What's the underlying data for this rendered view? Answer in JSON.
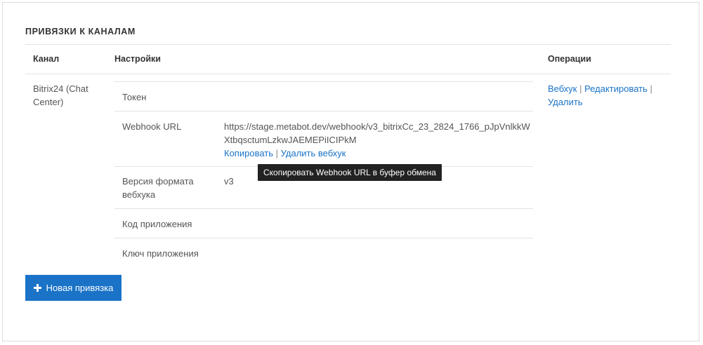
{
  "section": {
    "title": "ПРИВЯЗКИ К КАНАЛАМ"
  },
  "table": {
    "headers": {
      "channel": "Канал",
      "settings": "Настройки",
      "operations": "Операции"
    },
    "row": {
      "channel": "Bitrix24 (Chat Center)",
      "settings": [
        {
          "label": "Токен",
          "value": ""
        },
        {
          "label": "Webhook URL",
          "value": "https://stage.metabot.dev/webhook/v3_bitrixCc_23_2824_1766_pJpVnlkkWXtbqsctumLzkwJAEMEPiICIPkM"
        },
        {
          "label": "Версия формата вебхука",
          "value": "v3"
        },
        {
          "label": "Код приложения",
          "value": ""
        },
        {
          "label": "Ключ приложения",
          "value": ""
        }
      ],
      "webhook_actions": {
        "copy": "Копировать",
        "separator": "|",
        "delete": "Удалить вебхук"
      },
      "operations": {
        "webhook": "Вебхук",
        "edit": "Редактировать",
        "delete": "Удалить",
        "separator": "|"
      }
    }
  },
  "tooltip": {
    "text": "Скопировать Webhook URL в буфер обмена"
  },
  "buttons": {
    "new_binding": "Новая привязка",
    "new_binding_icon": "plus-icon"
  },
  "colors": {
    "link": "#1a73c7",
    "button_bg": "#1a73c7",
    "tooltip_bg": "#222222"
  }
}
